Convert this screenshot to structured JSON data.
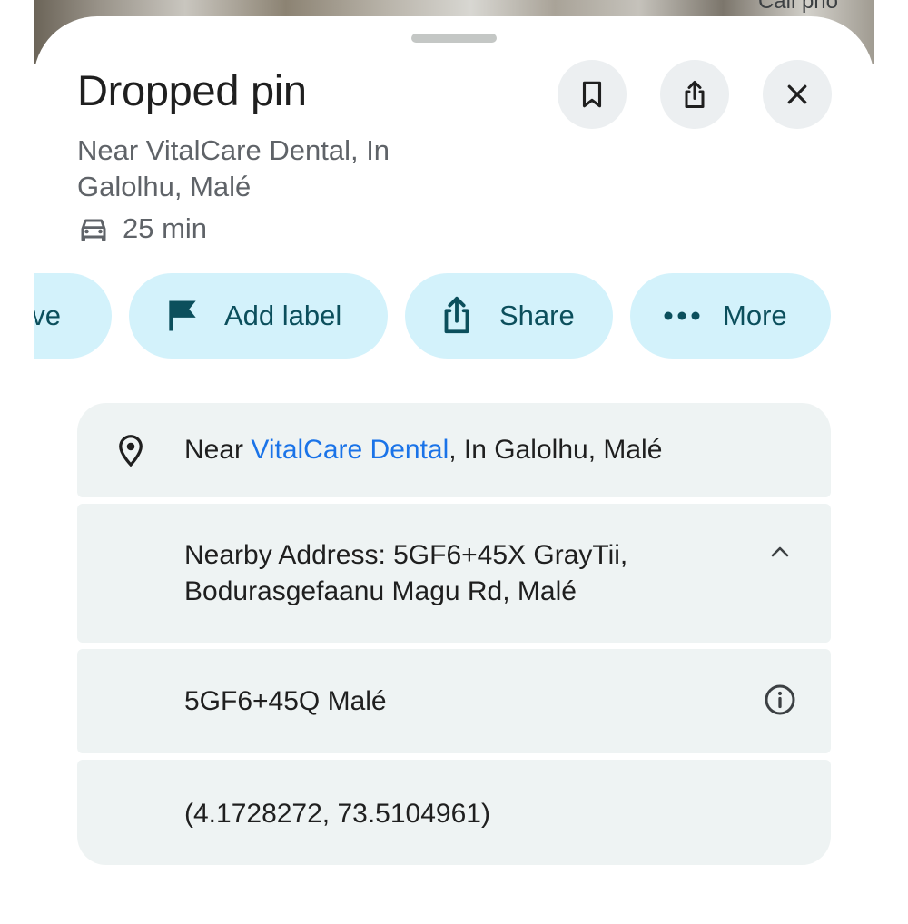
{
  "map": {
    "corner_text": "Call pho"
  },
  "place": {
    "title": "Dropped pin",
    "subtitle": "Near VitalCare Dental, In Galolhu, Malé",
    "eta": "25 min",
    "eta_icon": "car-icon"
  },
  "header_actions": {
    "save_icon": "bookmark-icon",
    "share_icon": "share-icon",
    "close_icon": "close-icon"
  },
  "chips": [
    {
      "label": "ave",
      "icon": "bookmark-icon"
    },
    {
      "label": "Add label",
      "icon": "flag-icon"
    },
    {
      "label": "Share",
      "icon": "share-icon"
    },
    {
      "label": "More",
      "icon": "more-horiz-icon"
    }
  ],
  "details": {
    "location": {
      "prefix": "Near ",
      "link": "VitalCare Dental",
      "suffix": ", In Galolhu, Malé",
      "icon": "location-pin-icon"
    },
    "nearby_address": {
      "line1": "Nearby Address: 5GF6+45X GrayTii,",
      "line2": "Bodurasgefaanu Magu Rd, Malé",
      "icon": "chevron-up-icon"
    },
    "plus_code": {
      "text": "5GF6+45Q Malé",
      "icon": "info-icon"
    },
    "coordinates": {
      "text": "(4.1728272, 73.5104961)"
    }
  },
  "colors": {
    "chip_bg": "#d3f2fb",
    "chip_text": "#0b4f5c",
    "card_bg": "#eef3f3",
    "link": "#1a73e8"
  }
}
